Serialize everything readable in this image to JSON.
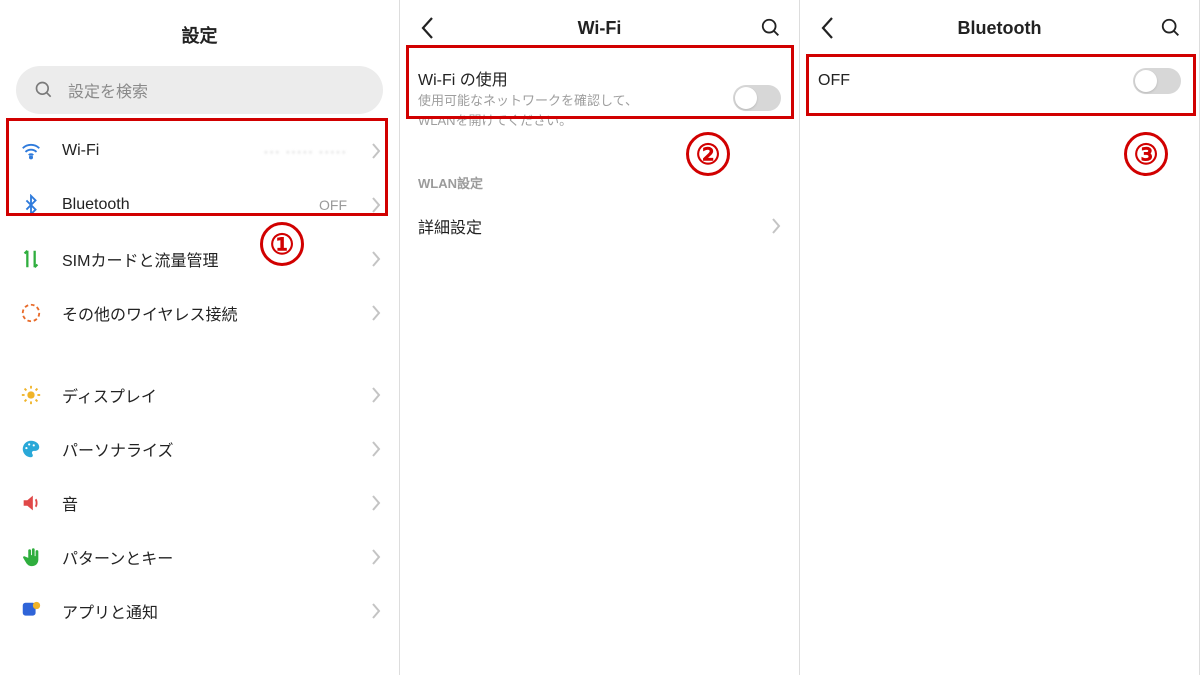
{
  "panel1": {
    "title": "設定",
    "search_placeholder": "設定を検索",
    "items": [
      {
        "label": "Wi-Fi",
        "value_masked": "··· ····· ·····",
        "icon": "wifi",
        "color": "#2f7bdc"
      },
      {
        "label": "Bluetooth",
        "value": "OFF",
        "icon": "bluetooth",
        "color": "#2f7bdc"
      },
      {
        "label": "SIMカードと流量管理",
        "icon": "sim",
        "color": "#2fae3e"
      },
      {
        "label": "その他のワイヤレス接続",
        "icon": "wireless",
        "color": "#e86b2a"
      },
      {
        "label": "ディスプレイ",
        "icon": "brightness",
        "color": "#f0b429"
      },
      {
        "label": "パーソナライズ",
        "icon": "palette",
        "color": "#29a8d8"
      },
      {
        "label": "音",
        "icon": "sound",
        "color": "#e04848"
      },
      {
        "label": "パターンとキー",
        "icon": "hand",
        "color": "#2fae3e"
      },
      {
        "label": "アプリと通知",
        "icon": "apps",
        "color": "#2f64d8"
      }
    ]
  },
  "panel2": {
    "title": "Wi-Fi",
    "toggle_title": "Wi-Fi の使用",
    "toggle_sub1": "使用可能なネットワークを確認して、",
    "toggle_sub2": "WLANを開けてください。",
    "section_label": "WLAN設定",
    "adv_label": "詳細設定"
  },
  "panel3": {
    "title": "Bluetooth",
    "toggle_title": "OFF"
  },
  "annotations": {
    "num1": "①",
    "num2": "②",
    "num3": "③"
  }
}
